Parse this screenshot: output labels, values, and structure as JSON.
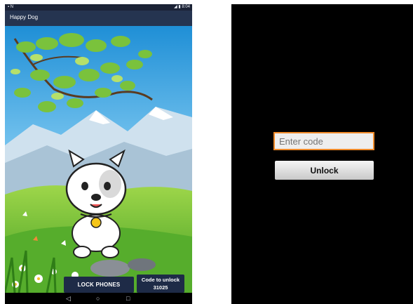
{
  "left_screen": {
    "status": {
      "left": "▪ N",
      "right": "◢ ▮ 8:04"
    },
    "app_title": "Happy Dog",
    "lock_button": "LOCK PHONES",
    "code_label": "Code to unlock",
    "code_value": "31025",
    "nav": {
      "back": "◁",
      "home": "○",
      "recent": "□"
    }
  },
  "right_screen": {
    "input_placeholder": "Enter code",
    "unlock_button": "Unlock"
  },
  "colors": {
    "appbar": "#253450",
    "button": "#1e2b47",
    "input_border": "#ef8a2a"
  }
}
